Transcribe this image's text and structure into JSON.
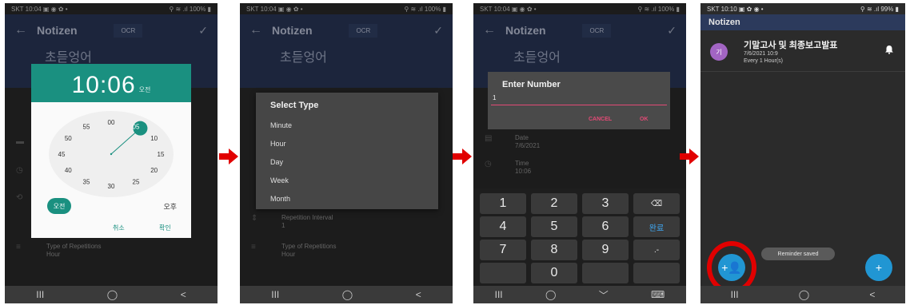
{
  "colors": {
    "accent_teal": "#1a9080",
    "appbar": "#2c3a5c",
    "dialog_action": "#e34a76",
    "fab_blue": "#2196d3",
    "annotation_red": "#e10000"
  },
  "screen1": {
    "status_left": "SKT 10:04 ▣ ◉ ✿ •",
    "status_right": "⚲ ≋ .ıl 100% ▮",
    "app_title": "Notizen",
    "ocr_label": "OCR",
    "note_title": "초듣엉어",
    "picker": {
      "time": "10:06",
      "ampm_head": "오전",
      "minutes": [
        "00",
        "05",
        "10",
        "15",
        "20",
        "25",
        "30",
        "35",
        "40",
        "45",
        "50",
        "55"
      ],
      "am_label": "오전",
      "pm_label": "오후",
      "cancel": "취소",
      "ok": "확인"
    },
    "rows": {
      "repetition_type_label": "Type of Repetitions",
      "repetition_type_value": "Hour"
    },
    "nav": [
      "III",
      "◯",
      "<"
    ]
  },
  "screen2": {
    "status_left": "SKT 10:04 ▣ ◉ ✿ •",
    "status_right": "⚲ ≋ .ıl 100% ▮",
    "app_title": "Notizen",
    "ocr_label": "OCR",
    "note_title": "초듣엉어",
    "dialog_title": "Select Type",
    "options": [
      "Minute",
      "Hour",
      "Day",
      "Week",
      "Month"
    ],
    "rows": {
      "interval_label": "Repetition Interval",
      "interval_value": "1",
      "type_label": "Type of Repetitions",
      "type_value": "Hour"
    },
    "nav": [
      "III",
      "◯",
      "<"
    ]
  },
  "screen3": {
    "status_left": "SKT 10:04 ▣ ◉ ✿ •",
    "status_right": "⚲ ≋ .ıl 100% ▮",
    "app_title": "Notizen",
    "ocr_label": "OCR",
    "note_title": "초듣엉어",
    "dialog_title": "Enter Number",
    "input_value": "1",
    "cancel": "CANCEL",
    "ok": "OK",
    "rows": {
      "date_label": "Date",
      "date_value": "7/6/2021",
      "time_label": "Time",
      "time_value": "10:06"
    },
    "keys": [
      "1",
      "2",
      "3",
      "⌫",
      "4",
      "5",
      "6",
      "완료",
      "7",
      "8",
      "9",
      ".-",
      "",
      "0",
      "",
      ""
    ],
    "nav": [
      "III",
      "◯",
      "﹀",
      "⌨"
    ]
  },
  "screen4": {
    "status_left": "SKT 10:10 ▣ ✿ ◉ •",
    "status_right": "⚲ ≋ .ıl 99% ▮",
    "app_title": "Notizen",
    "item": {
      "avatar": "기",
      "title": "기말고사 및 최종보고발표",
      "date": "7/6/2021 10:9",
      "repeat": "Every 1 Hour(s)"
    },
    "toast": "Reminder saved",
    "fab_left": "+👤",
    "fab_right": "+",
    "nav": [
      "III",
      "◯",
      "<"
    ]
  }
}
